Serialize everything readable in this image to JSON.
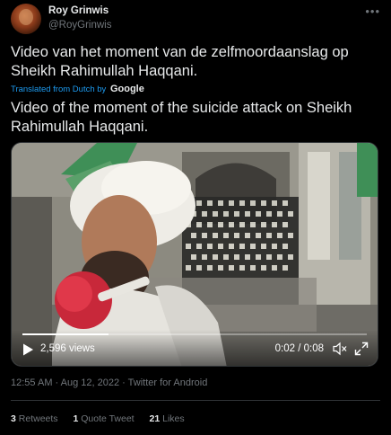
{
  "author": {
    "name": "Roy Grinwis",
    "handle": "@RoyGrinwis",
    "more_icon": "ellipsis-icon"
  },
  "tweet": {
    "text": "Video van het moment van de zelfmoordaanslag op Sheikh Rahimullah Haqqani.",
    "translated_label": "Translated from Dutch by",
    "translator": "Google",
    "translation": "Video of the moment of the suicide attack on Sheikh Rahimullah Haqqani."
  },
  "video": {
    "views": "2,596 views",
    "time": "0:02 / 0:08",
    "progress": 0.25,
    "icons": [
      "play-icon",
      "mute-icon",
      "fullscreen-icon"
    ]
  },
  "meta": {
    "timestamp": "12:55 AM · Aug 12, 2022 · Twitter for Android"
  },
  "stats": {
    "retweets_count": "3",
    "retweets_label": "Retweets",
    "quotes_count": "1",
    "quotes_label": "Quote Tweet",
    "likes_count": "21",
    "likes_label": "Likes"
  },
  "colors": {
    "background": "#000000",
    "text": "#e7e9ea",
    "secondary": "#71767b",
    "link": "#1d9bf0"
  }
}
